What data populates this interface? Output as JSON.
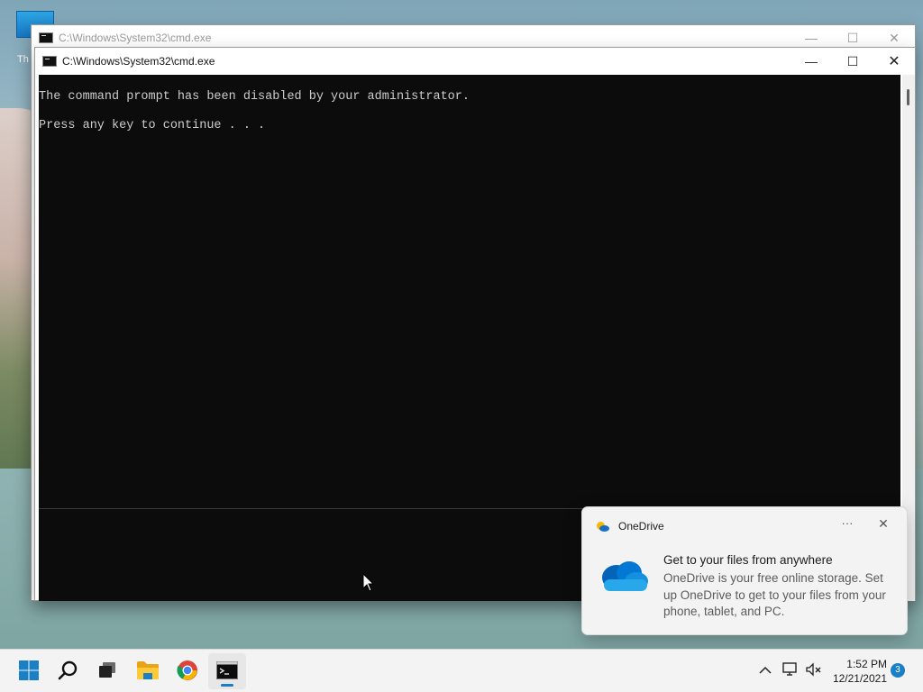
{
  "desktop": {
    "icon_label": "Th"
  },
  "bg_window": {
    "title": "C:\\Windows\\System32\\cmd.exe",
    "minimize": "—",
    "maximize": "☐",
    "close": "✕"
  },
  "cmd_window": {
    "title": "C:\\Windows\\System32\\cmd.exe",
    "minimize": "—",
    "maximize": "☐",
    "close": "✕",
    "console_lines": [
      "The command prompt has been disabled by your administrator.",
      "",
      "Press any key to continue . . ."
    ]
  },
  "toast": {
    "app_name": "OneDrive",
    "more_glyph": "···",
    "close_glyph": "✕",
    "title": "Get to your files from anywhere",
    "body": "OneDrive is your free online storage. Set up OneDrive to get to your files from your phone, tablet, and PC.",
    "icon": "onedrive-cloud-icon"
  },
  "taskbar": {
    "items": [
      "start-icon",
      "search-icon",
      "task-view-icon",
      "file-explorer-icon",
      "chrome-icon",
      "command-prompt-icon"
    ],
    "chevron_glyph": "^",
    "time": "1:52 PM",
    "date": "12/21/2021",
    "notification_count": "3",
    "accent": "#1a7fc4"
  }
}
